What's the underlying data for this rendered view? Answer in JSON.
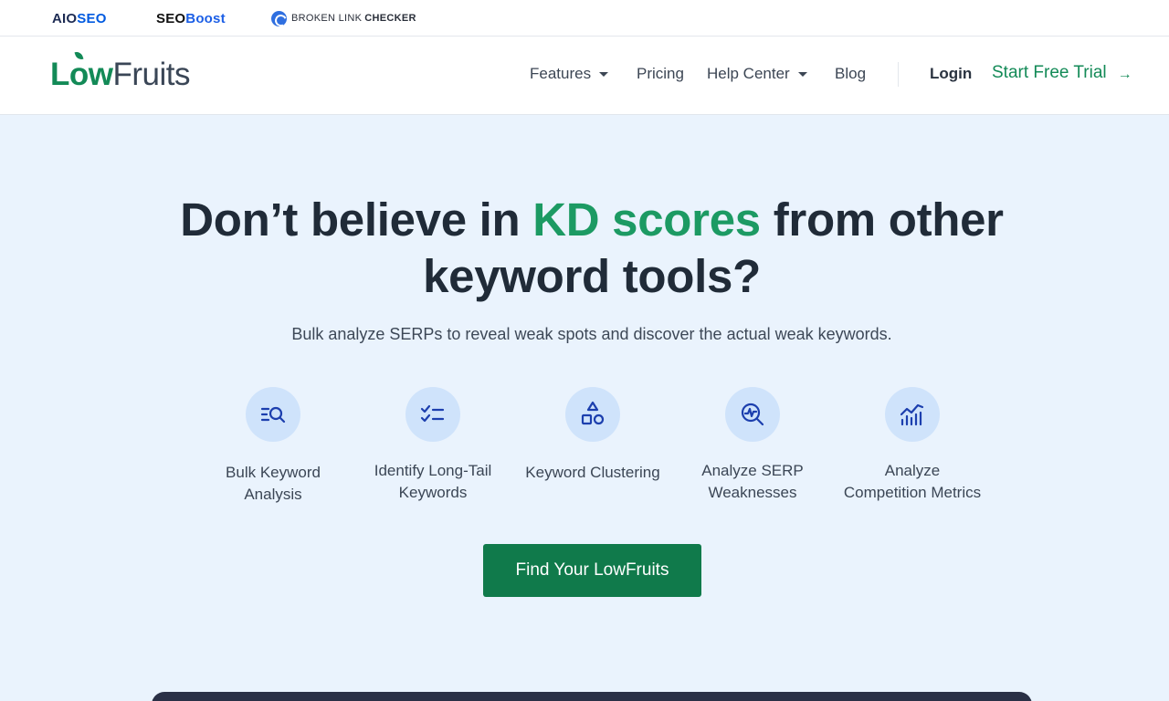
{
  "brandbar": {
    "aioseo": {
      "part1": "AIO",
      "part2": "SEO"
    },
    "seoboost": {
      "part1": "SEO",
      "part2": "Boost"
    },
    "blc": {
      "part1": "BROKEN LINK",
      "part2": "CHECKER"
    }
  },
  "nav": {
    "logo": {
      "part1": "L",
      "part2": "w",
      "part3": "Fruits",
      "o": "o"
    },
    "items": [
      {
        "label": "Features",
        "has_dropdown": true
      },
      {
        "label": "Pricing",
        "has_dropdown": false
      },
      {
        "label": "Help Center",
        "has_dropdown": true
      },
      {
        "label": "Blog",
        "has_dropdown": false
      }
    ],
    "login": "Login",
    "trial": "Start Free Trial",
    "trial_arrow": "→"
  },
  "hero": {
    "title_pre": "Don’t believe in ",
    "title_accent": "KD scores",
    "title_post": " from other keyword tools?",
    "subtitle": "Bulk analyze SERPs to reveal weak spots and discover the actual weak keywords.",
    "features": [
      {
        "icon": "bulk-search-icon",
        "line1": "Bulk Keyword",
        "line2": "Analysis"
      },
      {
        "icon": "checklist-icon",
        "line1": "Identify Long-Tail",
        "line2": "Keywords"
      },
      {
        "icon": "shapes-icon",
        "line1": "Keyword Clustering",
        "line2": ""
      },
      {
        "icon": "serp-analysis-icon",
        "line1": "Analyze SERP",
        "line2": "Weaknesses"
      },
      {
        "icon": "metrics-chart-icon",
        "line1": "Analyze",
        "line2": "Competition Metrics"
      }
    ],
    "cta": "Find Your LowFruits"
  },
  "colors": {
    "accent_green": "#1c9a63",
    "cta_green": "#107a4b",
    "hero_bg": "#eaf3fd",
    "icon_circle": "#cfe3fb",
    "icon_stroke": "#1c3fae"
  }
}
